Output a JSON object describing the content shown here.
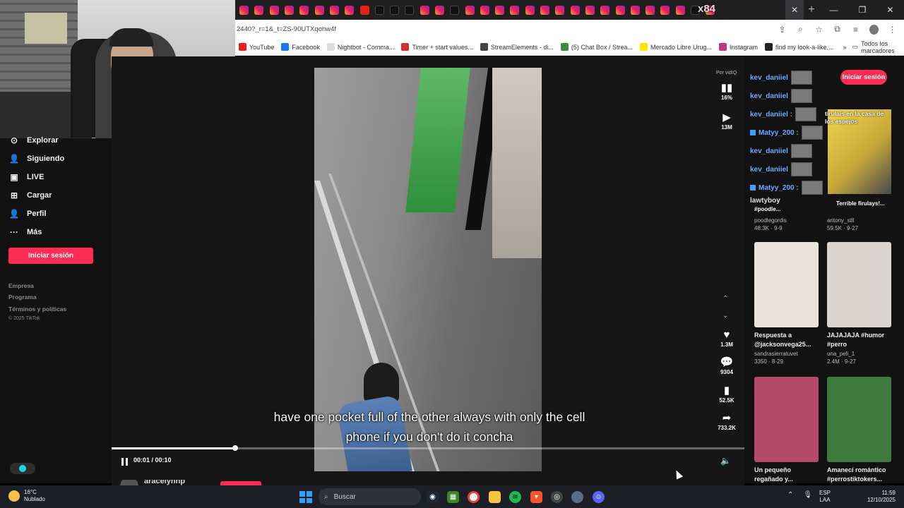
{
  "browser": {
    "tabs": [
      "ig",
      "ig",
      "ig",
      "ig",
      "ig",
      "ig",
      "ig",
      "ig",
      "yt",
      "tt",
      "tt",
      "tt",
      "ig",
      "ig",
      "tt",
      "ig",
      "ig",
      "ig",
      "ig",
      "ig",
      "ig",
      "ig",
      "ig",
      "ig",
      "ig",
      "ig",
      "ig",
      "ig",
      "ig",
      "ig",
      "tt",
      "ig"
    ],
    "active_close": "✕",
    "new_tab": "+",
    "url": "2440?_r=1&_t=ZS-90UTXqohw4f",
    "overlay_text": "x84"
  },
  "bookmarks": [
    {
      "label": "YouTube",
      "color": "#e62117"
    },
    {
      "label": "Facebook",
      "color": "#1877f2"
    },
    {
      "label": "Nightbot - Comma...",
      "color": "#dddddd"
    },
    {
      "label": "Timer + start values...",
      "color": "#d32f2f"
    },
    {
      "label": "StreamElements - di...",
      "color": "#444444"
    },
    {
      "label": "(5) Chat Box / Strea...",
      "color": "#3d8b40"
    },
    {
      "label": "Mercado Libre Urug...",
      "color": "#ffe600"
    },
    {
      "label": "Instagram",
      "color": "#c13584"
    },
    {
      "label": "find my look-a-like,...",
      "color": "#222222"
    }
  ],
  "bookmarks_more": "»",
  "bookmarks_folder": "Todos los marcadores",
  "sidebar": {
    "items": [
      {
        "label": "Explorar",
        "icon": "compass-icon",
        "glyph": "⊙"
      },
      {
        "label": "Siguiendo",
        "icon": "following-icon",
        "glyph": "👤"
      },
      {
        "label": "LIVE",
        "icon": "live-icon",
        "glyph": "▣"
      },
      {
        "label": "Cargar",
        "icon": "upload-icon",
        "glyph": "⊞"
      },
      {
        "label": "Perfil",
        "icon": "profile-icon",
        "glyph": "👤"
      },
      {
        "label": "Más",
        "icon": "more-icon",
        "glyph": "···"
      }
    ],
    "login": "Iniciar sesión",
    "footer": [
      "Empresa",
      "Programa",
      "Términos y políticas"
    ],
    "copyright": "© 2025 TikTok"
  },
  "video": {
    "subtitle_line1": "have one pocket full of the other always with only the cell",
    "subtitle_line2": "phone if you don't do it concha",
    "time": "00:01 / 00:10",
    "progress": 0.195,
    "vidiq_label": "Por vidIQ",
    "actions": {
      "vidiq_pct": "16%",
      "views": "13M",
      "likes": "1.3M",
      "comments": "9304",
      "saves": "52.5K",
      "shares": "733.2K"
    },
    "below_name": "aracelynnp"
  },
  "right": {
    "login": "Iniciar sesión",
    "chat": [
      {
        "user": "kev_daniiel",
        "badge": false
      },
      {
        "user": "kev_daniiel",
        "badge": false
      },
      {
        "user": "kev_daniiel :",
        "badge": false
      },
      {
        "user": "Matyy_200 :",
        "badge": true
      },
      {
        "user": "kev_daniiel",
        "badge": false
      },
      {
        "user": "kev_daniiel",
        "badge": false
      },
      {
        "user": "Matyy_200 :",
        "badge": true
      }
    ],
    "chat_extra": "lawtyboy",
    "overlay_title": "tirulais en la casa de los espejos",
    "top_cards": [
      {
        "title": "#poodle...",
        "author": "poodlegordis",
        "meta": "48.3K · 9-9"
      },
      {
        "title": "Terrible firulays!...",
        "author": "antony_stll",
        "meta": "59.5K · 9-27"
      }
    ],
    "cards": [
      {
        "title": "Respuesta a @jacksonvega25...",
        "author": "sandrasierratuvet",
        "meta": "3350 · 8-29",
        "bg": "#e8e3dc"
      },
      {
        "title": "JAJAJAJA #humor #perro",
        "author": "una_peli_1",
        "meta": "2.4M · 9-27",
        "bg": "#d9d4cf"
      },
      {
        "title": "Un pequeño regañado y...",
        "author": "",
        "meta": "",
        "bg": "#b44a6a"
      },
      {
        "title": "Amanecí romántico #perrostiktokers...",
        "author": "",
        "meta": "",
        "bg": "#3e7a3e"
      }
    ]
  },
  "taskbar": {
    "weather_temp": "16°C",
    "weather_desc": "Nublado",
    "search": "Buscar",
    "lang1": "ESP",
    "lang2": "LAA",
    "time": "11:59",
    "date": "12/10/2025"
  },
  "colors": {
    "accent": "#fe2c55",
    "tiktok_cyan": "#20d5ec"
  }
}
